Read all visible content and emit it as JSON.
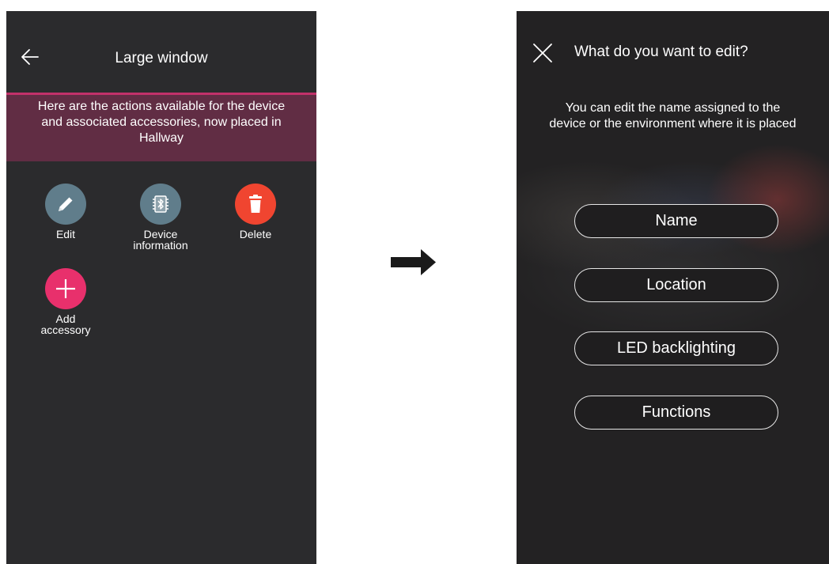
{
  "left_screen": {
    "title": "Large window",
    "banner_lines": [
      "Here are the actions available for the device",
      "and associated accessories, now placed in",
      "Hallway"
    ],
    "actions": {
      "edit": {
        "label": "Edit",
        "icon": "pencil-icon",
        "color": "#607d8b"
      },
      "device_info": {
        "label_lines": [
          "Device",
          "information"
        ],
        "icon": "bluetooth-chip-icon",
        "color": "#607d8b"
      },
      "delete": {
        "label": "Delete",
        "icon": "trash-icon",
        "color": "#f04530"
      },
      "add_accessory": {
        "label_lines": [
          "Add",
          "accessory"
        ],
        "icon": "plus-icon",
        "color": "#e8306c"
      }
    },
    "accent_color": "#c2316a"
  },
  "right_screen": {
    "title": "What do you want to edit?",
    "description_lines": [
      "You can edit the name assigned to the",
      "device or the environment where it is placed"
    ],
    "options": [
      "Name",
      "Location",
      "LED backlighting",
      "Functions"
    ]
  }
}
